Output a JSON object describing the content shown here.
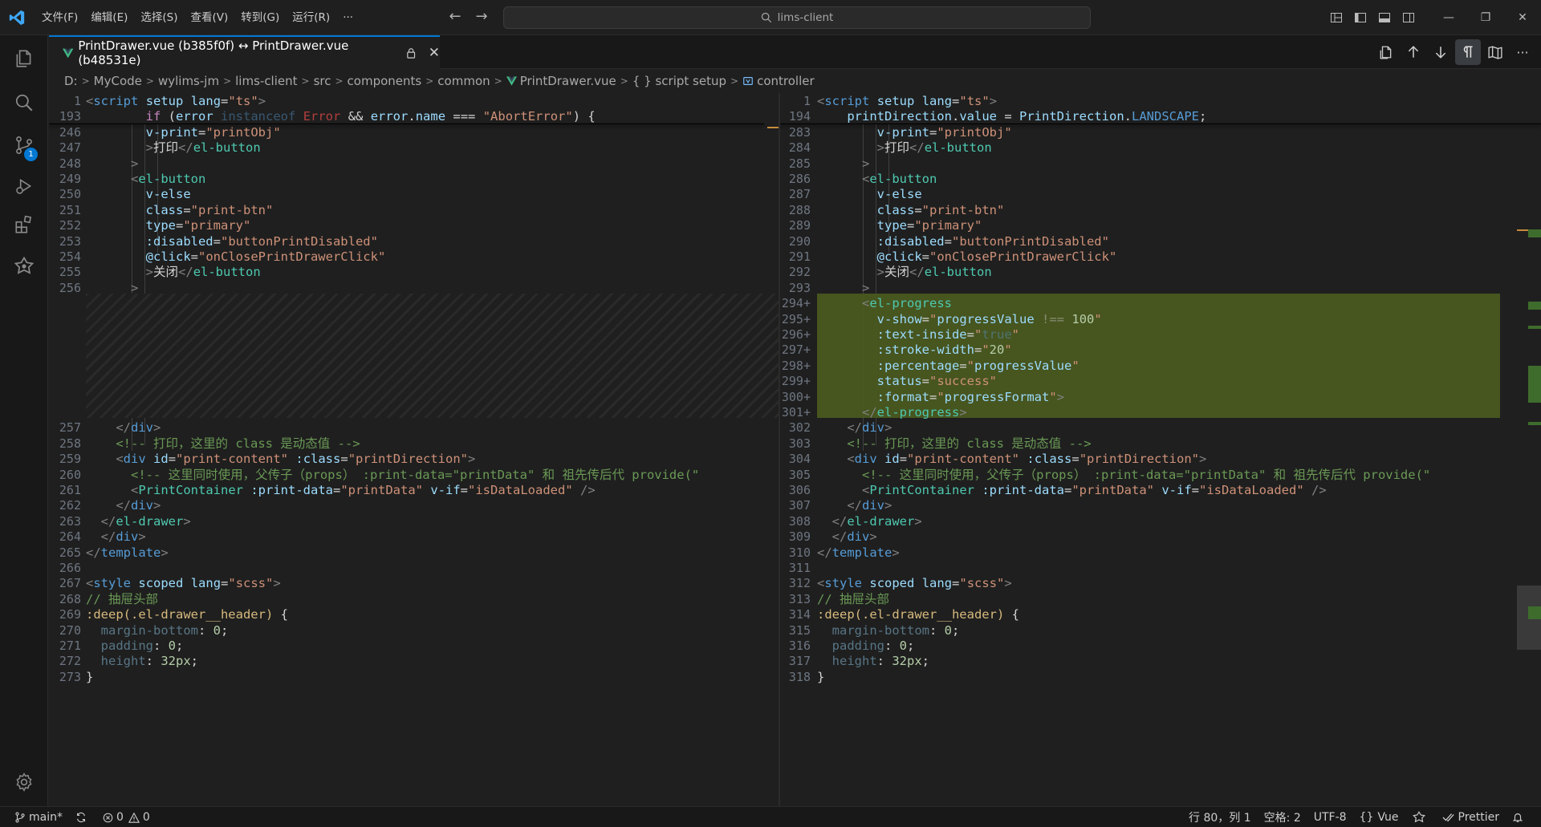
{
  "window": {
    "search": "lims-client"
  },
  "menu": [
    "文件(F)",
    "编辑(E)",
    "选择(S)",
    "查看(V)",
    "转到(G)",
    "运行(R)",
    "···"
  ],
  "scm_badge": "1",
  "tab": {
    "title": "PrintDrawer.vue (b385f0f) ↔ PrintDrawer.vue (b48531e)",
    "close": "✕"
  },
  "breadcrumbs": [
    "D:",
    "MyCode",
    "wylims-jm",
    "lims-client",
    "src",
    "components",
    "common",
    "PrintDrawer.vue",
    "{ } script setup",
    "controller"
  ],
  "left": {
    "sticky": [
      {
        "ln": "1",
        "html": "<span class=\"p\">&lt;</span><span class=\"k\">script</span> <span class=\"a\">setup</span> <span class=\"a\">lang</span>=<span class=\"s\">\"ts\"</span><span class=\"p\">&gt;</span>"
      },
      {
        "ln": "193",
        "html": "        <span class=\"ctl\">if</span> (<span class=\"v\">error</span> <span class=\"k dim\">instanceof</span> <span class=\"err\">Error</span> &amp;&amp; <span class=\"v\">error</span>.<span class=\"v\">name</span> === <span class=\"s\">\"AbortError\"</span>) {"
      }
    ],
    "top": [
      {
        "ln": "246",
        "html": "        <span class=\"a\">v-print</span>=<span class=\"s\">\"printObj\"</span>"
      },
      {
        "ln": "247",
        "html": "        <span class=\"p\">&gt;</span>打印<span class=\"p\">&lt;/</span><span class=\"t\">el-button</span>"
      },
      {
        "ln": "248",
        "html": "      <span class=\"p\">&gt;</span>"
      },
      {
        "ln": "249",
        "html": "      <span class=\"p\">&lt;</span><span class=\"t\">el-button</span>"
      },
      {
        "ln": "250",
        "html": "        <span class=\"a\">v-else</span>"
      },
      {
        "ln": "251",
        "html": "        <span class=\"a\">class</span>=<span class=\"s\">\"print-btn\"</span>"
      },
      {
        "ln": "252",
        "html": "        <span class=\"a\">type</span>=<span class=\"s\">\"primary\"</span>"
      },
      {
        "ln": "253",
        "html": "        <span class=\"a\">:disabled</span>=<span class=\"s\">\"buttonPrintDisabled\"</span>"
      },
      {
        "ln": "254",
        "html": "        <span class=\"a\">@click</span>=<span class=\"s\">\"onClosePrintDrawerClick\"</span>"
      },
      {
        "ln": "255",
        "html": "        <span class=\"p\">&gt;</span>关闭<span class=\"p\">&lt;/</span><span class=\"t\">el-button</span>"
      },
      {
        "ln": "256",
        "html": "      <span class=\"p\">&gt;</span>"
      }
    ],
    "bottom": [
      {
        "ln": "257",
        "html": "    <span class=\"p\">&lt;/</span><span class=\"k\">div</span><span class=\"p\">&gt;</span>"
      },
      {
        "ln": "258",
        "html": "    <span class=\"c\">&lt;!-- 打印，这里的 class 是动态值 --&gt;</span>"
      },
      {
        "ln": "259",
        "html": "    <span class=\"p\">&lt;</span><span class=\"k\">div</span> <span class=\"a\">id</span>=<span class=\"s\">\"print-content\"</span> <span class=\"a\">:class</span>=<span class=\"s\">\"printDirection\"</span><span class=\"p\">&gt;</span>"
      },
      {
        "ln": "260",
        "html": "      <span class=\"c\">&lt;!-- 这里同时使用，父传子（props） :print-data=\"printData\" 和 祖先传后代 provide(\"</span>"
      },
      {
        "ln": "261",
        "html": "      <span class=\"p\">&lt;</span><span class=\"t\">PrintContainer</span> <span class=\"a\">:print-data</span>=<span class=\"s\">\"printData\"</span> <span class=\"a\">v-if</span>=<span class=\"s\">\"isDataLoaded\"</span> <span class=\"p\">/&gt;</span>"
      },
      {
        "ln": "262",
        "html": "    <span class=\"p\">&lt;/</span><span class=\"k\">div</span><span class=\"p\">&gt;</span>"
      },
      {
        "ln": "263",
        "html": "  <span class=\"p\">&lt;/</span><span class=\"t\">el-drawer</span><span class=\"p\">&gt;</span>"
      },
      {
        "ln": "264",
        "html": "  <span class=\"p\">&lt;/</span><span class=\"k\">div</span><span class=\"p\">&gt;</span>"
      },
      {
        "ln": "265",
        "html": "<span class=\"p\">&lt;/</span><span class=\"k\">template</span><span class=\"p\">&gt;</span>"
      },
      {
        "ln": "266",
        "html": ""
      },
      {
        "ln": "267",
        "html": "<span class=\"p\">&lt;</span><span class=\"k\">style</span> <span class=\"a\">scoped</span> <span class=\"a\">lang</span>=<span class=\"s\">\"scss\"</span><span class=\"p\">&gt;</span>"
      },
      {
        "ln": "268",
        "html": "<span class=\"c\">// 抽屉头部</span>"
      },
      {
        "ln": "269",
        "html": "<span class=\"cls\">:deep(.el-drawer__header)</span> {"
      },
      {
        "ln": "270",
        "html": "  <span class=\"a dim\">margin-bottom</span>: <span class=\"n\">0</span>;"
      },
      {
        "ln": "271",
        "html": "  <span class=\"a dim\">padding</span>: <span class=\"n\">0</span>;"
      },
      {
        "ln": "272",
        "html": "  <span class=\"a dim\">height</span>: <span class=\"n\">32px</span>;"
      },
      {
        "ln": "273",
        "html": "}"
      }
    ]
  },
  "right": {
    "sticky": [
      {
        "ln": "1",
        "html": "<span class=\"p\">&lt;</span><span class=\"k\">script</span> <span class=\"a\">setup</span> <span class=\"a\">lang</span>=<span class=\"s\">\"ts\"</span><span class=\"p\">&gt;</span>"
      },
      {
        "ln": "194",
        "html": "    <span class=\"v\">printDirection</span>.<span class=\"v\">value</span> = <span class=\"v\">PrintDirection</span>.<span class=\"k\">LANDSCAPE</span>;"
      }
    ],
    "top": [
      {
        "ln": "283",
        "html": "        <span class=\"a\">v-print</span>=<span class=\"s\">\"printObj\"</span>"
      },
      {
        "ln": "284",
        "html": "        <span class=\"p\">&gt;</span>打印<span class=\"p\">&lt;/</span><span class=\"t\">el-button</span>"
      },
      {
        "ln": "285",
        "html": "      <span class=\"p\">&gt;</span>"
      },
      {
        "ln": "286",
        "html": "      <span class=\"p\">&lt;</span><span class=\"t\">el-button</span>"
      },
      {
        "ln": "287",
        "html": "        <span class=\"a\">v-else</span>"
      },
      {
        "ln": "288",
        "html": "        <span class=\"a\">class</span>=<span class=\"s\">\"print-btn\"</span>"
      },
      {
        "ln": "289",
        "html": "        <span class=\"a\">type</span>=<span class=\"s\">\"primary\"</span>"
      },
      {
        "ln": "290",
        "html": "        <span class=\"a\">:disabled</span>=<span class=\"s\">\"buttonPrintDisabled\"</span>"
      },
      {
        "ln": "291",
        "html": "        <span class=\"a\">@click</span>=<span class=\"s\">\"onClosePrintDrawerClick\"</span>"
      },
      {
        "ln": "292",
        "html": "        <span class=\"p\">&gt;</span>关闭<span class=\"p\">&lt;/</span><span class=\"t\">el-button</span>"
      },
      {
        "ln": "293",
        "html": "      <span class=\"p\">&gt;</span>"
      }
    ],
    "added": [
      {
        "ln": "294+",
        "html": "      <span class=\"p\">&lt;</span><span class=\"t\">el-progress</span>"
      },
      {
        "ln": "295+",
        "html": "        <span class=\"a\">v-show</span>=<span class=\"s\">\"</span><span class=\"v\">progressValue</span> <span class=\"dim\">!==</span> <span class=\"n\">100</span><span class=\"s\">\"</span>"
      },
      {
        "ln": "296+",
        "html": "        <span class=\"a\">:text-inside</span>=<span class=\"s\">\"</span><span class=\"k dim\">true</span><span class=\"s\">\"</span>"
      },
      {
        "ln": "297+",
        "html": "        <span class=\"a\">:stroke-width</span>=<span class=\"s\">\"</span><span class=\"n\">20</span><span class=\"s\">\"</span>"
      },
      {
        "ln": "298+",
        "html": "        <span class=\"a\">:percentage</span>=<span class=\"s\">\"</span><span class=\"v\">progressValue</span><span class=\"s\">\"</span>"
      },
      {
        "ln": "299+",
        "html": "        <span class=\"a\">status</span>=<span class=\"s\">\"success\"</span>"
      },
      {
        "ln": "300+",
        "html": "        <span class=\"a\">:format</span>=<span class=\"s\">\"</span><span class=\"v\">progressFormat</span><span class=\"s\">\"</span><span class=\"p\">&gt;</span>"
      },
      {
        "ln": "301+",
        "html": "      <span class=\"p\">&lt;/</span><span class=\"t\">el-progress</span><span class=\"p\">&gt;</span>"
      }
    ],
    "bottom": [
      {
        "ln": "302",
        "html": "    <span class=\"p\">&lt;/</span><span class=\"k\">div</span><span class=\"p\">&gt;</span>"
      },
      {
        "ln": "303",
        "html": "    <span class=\"c\">&lt;!-- 打印，这里的 class 是动态值 --&gt;</span>"
      },
      {
        "ln": "304",
        "html": "    <span class=\"p\">&lt;</span><span class=\"k\">div</span> <span class=\"a\">id</span>=<span class=\"s\">\"print-content\"</span> <span class=\"a\">:class</span>=<span class=\"s\">\"printDirection\"</span><span class=\"p\">&gt;</span>"
      },
      {
        "ln": "305",
        "html": "      <span class=\"c\">&lt;!-- 这里同时使用，父传子（props） :print-data=\"printData\" 和 祖先传后代 provide(\"</span>"
      },
      {
        "ln": "306",
        "html": "      <span class=\"p\">&lt;</span><span class=\"t\">PrintContainer</span> <span class=\"a\">:print-data</span>=<span class=\"s\">\"printData\"</span> <span class=\"a\">v-if</span>=<span class=\"s\">\"isDataLoaded\"</span> <span class=\"p\">/&gt;</span>"
      },
      {
        "ln": "307",
        "html": "    <span class=\"p\">&lt;/</span><span class=\"k\">div</span><span class=\"p\">&gt;</span>"
      },
      {
        "ln": "308",
        "html": "  <span class=\"p\">&lt;/</span><span class=\"t\">el-drawer</span><span class=\"p\">&gt;</span>"
      },
      {
        "ln": "309",
        "html": "  <span class=\"p\">&lt;/</span><span class=\"k\">div</span><span class=\"p\">&gt;</span>"
      },
      {
        "ln": "310",
        "html": "<span class=\"p\">&lt;/</span><span class=\"k\">template</span><span class=\"p\">&gt;</span>"
      },
      {
        "ln": "311",
        "html": ""
      },
      {
        "ln": "312",
        "html": "<span class=\"p\">&lt;</span><span class=\"k\">style</span> <span class=\"a\">scoped</span> <span class=\"a\">lang</span>=<span class=\"s\">\"scss\"</span><span class=\"p\">&gt;</span>"
      },
      {
        "ln": "313",
        "html": "<span class=\"c\">// 抽屉头部</span>"
      },
      {
        "ln": "314",
        "html": "<span class=\"cls\">:deep(.el-drawer__header)</span> {"
      },
      {
        "ln": "315",
        "html": "  <span class=\"a dim\">margin-bottom</span>: <span class=\"n\">0</span>;"
      },
      {
        "ln": "316",
        "html": "  <span class=\"a dim\">padding</span>: <span class=\"n\">0</span>;"
      },
      {
        "ln": "317",
        "html": "  <span class=\"a dim\">height</span>: <span class=\"n\">32px</span>;"
      },
      {
        "ln": "318",
        "html": "}"
      }
    ]
  },
  "status": {
    "branch": "main*",
    "errors": "0",
    "warnings": "0",
    "position": "行 80，列 1",
    "spaces": "空格: 2",
    "encoding": "UTF-8",
    "language": "Vue",
    "formatter": "Prettier"
  },
  "colors": {
    "accent": "#0078d4",
    "added_bg": "#4b5a1f",
    "editor_bg": "#1f1f1f"
  }
}
